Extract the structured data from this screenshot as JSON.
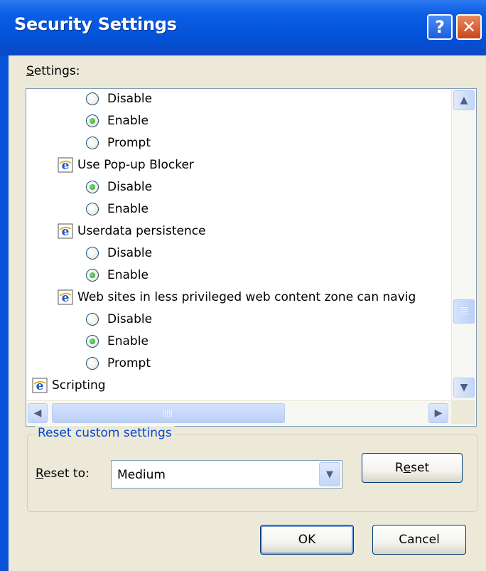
{
  "window": {
    "title": "Security Settings",
    "help_button": "?",
    "close_button": "✕"
  },
  "settings": {
    "label_accesskey": "S",
    "label_rest": "ettings:",
    "items": [
      {
        "type": "option",
        "label": "Disable",
        "selected": false
      },
      {
        "type": "option",
        "label": "Enable",
        "selected": true
      },
      {
        "type": "option",
        "label": "Prompt",
        "selected": false
      },
      {
        "type": "header",
        "label": "Use Pop-up Blocker"
      },
      {
        "type": "option",
        "label": "Disable",
        "selected": true
      },
      {
        "type": "option",
        "label": "Enable",
        "selected": false
      },
      {
        "type": "header",
        "label": "Userdata persistence"
      },
      {
        "type": "option",
        "label": "Disable",
        "selected": false
      },
      {
        "type": "option",
        "label": "Enable",
        "selected": true
      },
      {
        "type": "header",
        "label": "Web sites in less privileged web content zone can navig"
      },
      {
        "type": "option",
        "label": "Disable",
        "selected": false
      },
      {
        "type": "option",
        "label": "Enable",
        "selected": true
      },
      {
        "type": "option",
        "label": "Prompt",
        "selected": false
      },
      {
        "type": "header",
        "label": "Scripting"
      }
    ],
    "icon": "ie-settings-icon"
  },
  "reset_group": {
    "legend": "Reset custom settings",
    "reset_to_accesskey": "R",
    "reset_to_rest": "eset to:",
    "selected_level": "Medium",
    "reset_button_pre": "R",
    "reset_button_accesskey": "e",
    "reset_button_post": "set"
  },
  "buttons": {
    "ok": "OK",
    "cancel": "Cancel"
  },
  "colors": {
    "titlebar": "#0451d6",
    "dialog_face": "#ece9d8",
    "group_legend": "#0046d5"
  }
}
